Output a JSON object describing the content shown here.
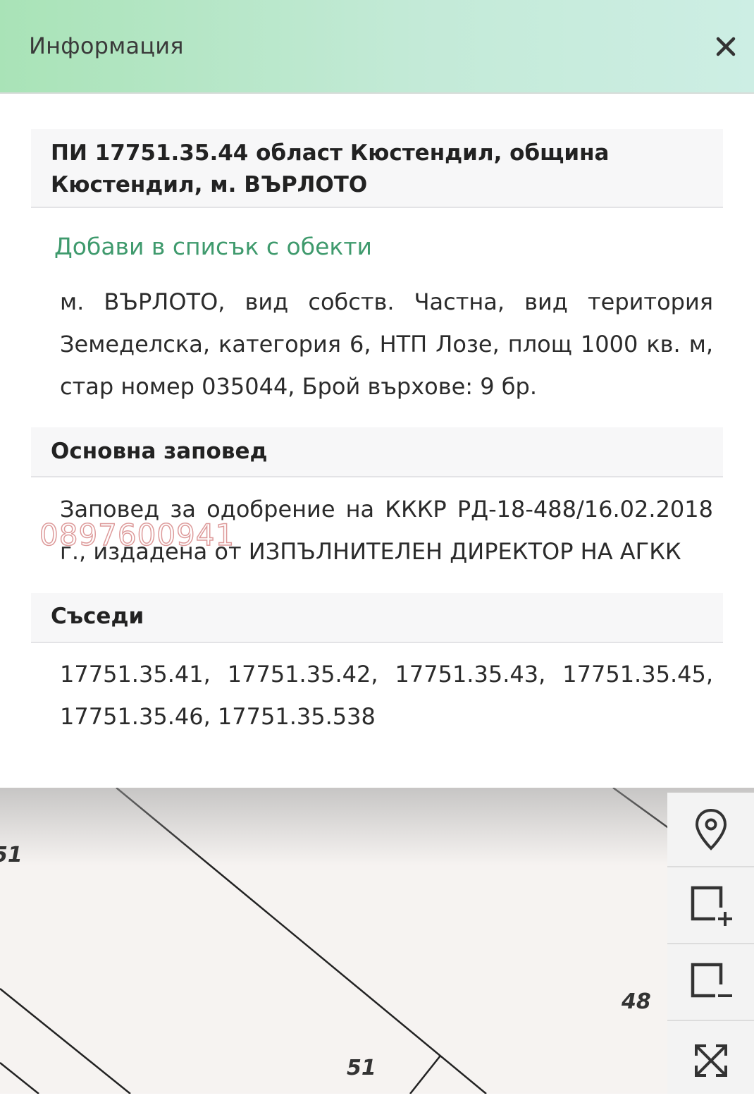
{
  "header": {
    "title": "Информация"
  },
  "parcel": {
    "title": "ПИ 17751.35.44 област Кюстендил, община Кюстендил, м. ВЪРЛОТО"
  },
  "actions": {
    "add_to_list": "Добави в списък с обекти"
  },
  "details": {
    "text": "м. ВЪРЛОТО, вид собств. Частна, вид територия Земеделска, категория 6, НТП Лозе, площ 1000 кв. м, стар номер 035044, Брой върхове: 9 бр."
  },
  "order": {
    "heading": "Основна заповед",
    "text": "Заповед за одобрение на КККР РД-18-488/16.02.2018 г., издадена от ИЗПЪЛНИТЕЛЕН ДИРЕКТОР НА АГКК"
  },
  "watermark": {
    "text": "0897600941"
  },
  "neighbours": {
    "heading": "Съседи",
    "text": "17751.35.41, 17751.35.42, 17751.35.43, 17751.35.45, 17751.35.46, 17751.35.538"
  },
  "map": {
    "labels": [
      "51",
      "48",
      "51"
    ]
  },
  "icons": {
    "close": "close-icon",
    "location": "location-pin-icon",
    "add_area": "add-area-icon",
    "remove_area": "remove-area-icon",
    "fullscreen": "fullscreen-icon"
  },
  "colors": {
    "accent_link": "#3f9a6d",
    "header_start": "#a9e3b7",
    "header_end": "#cdeee4"
  }
}
